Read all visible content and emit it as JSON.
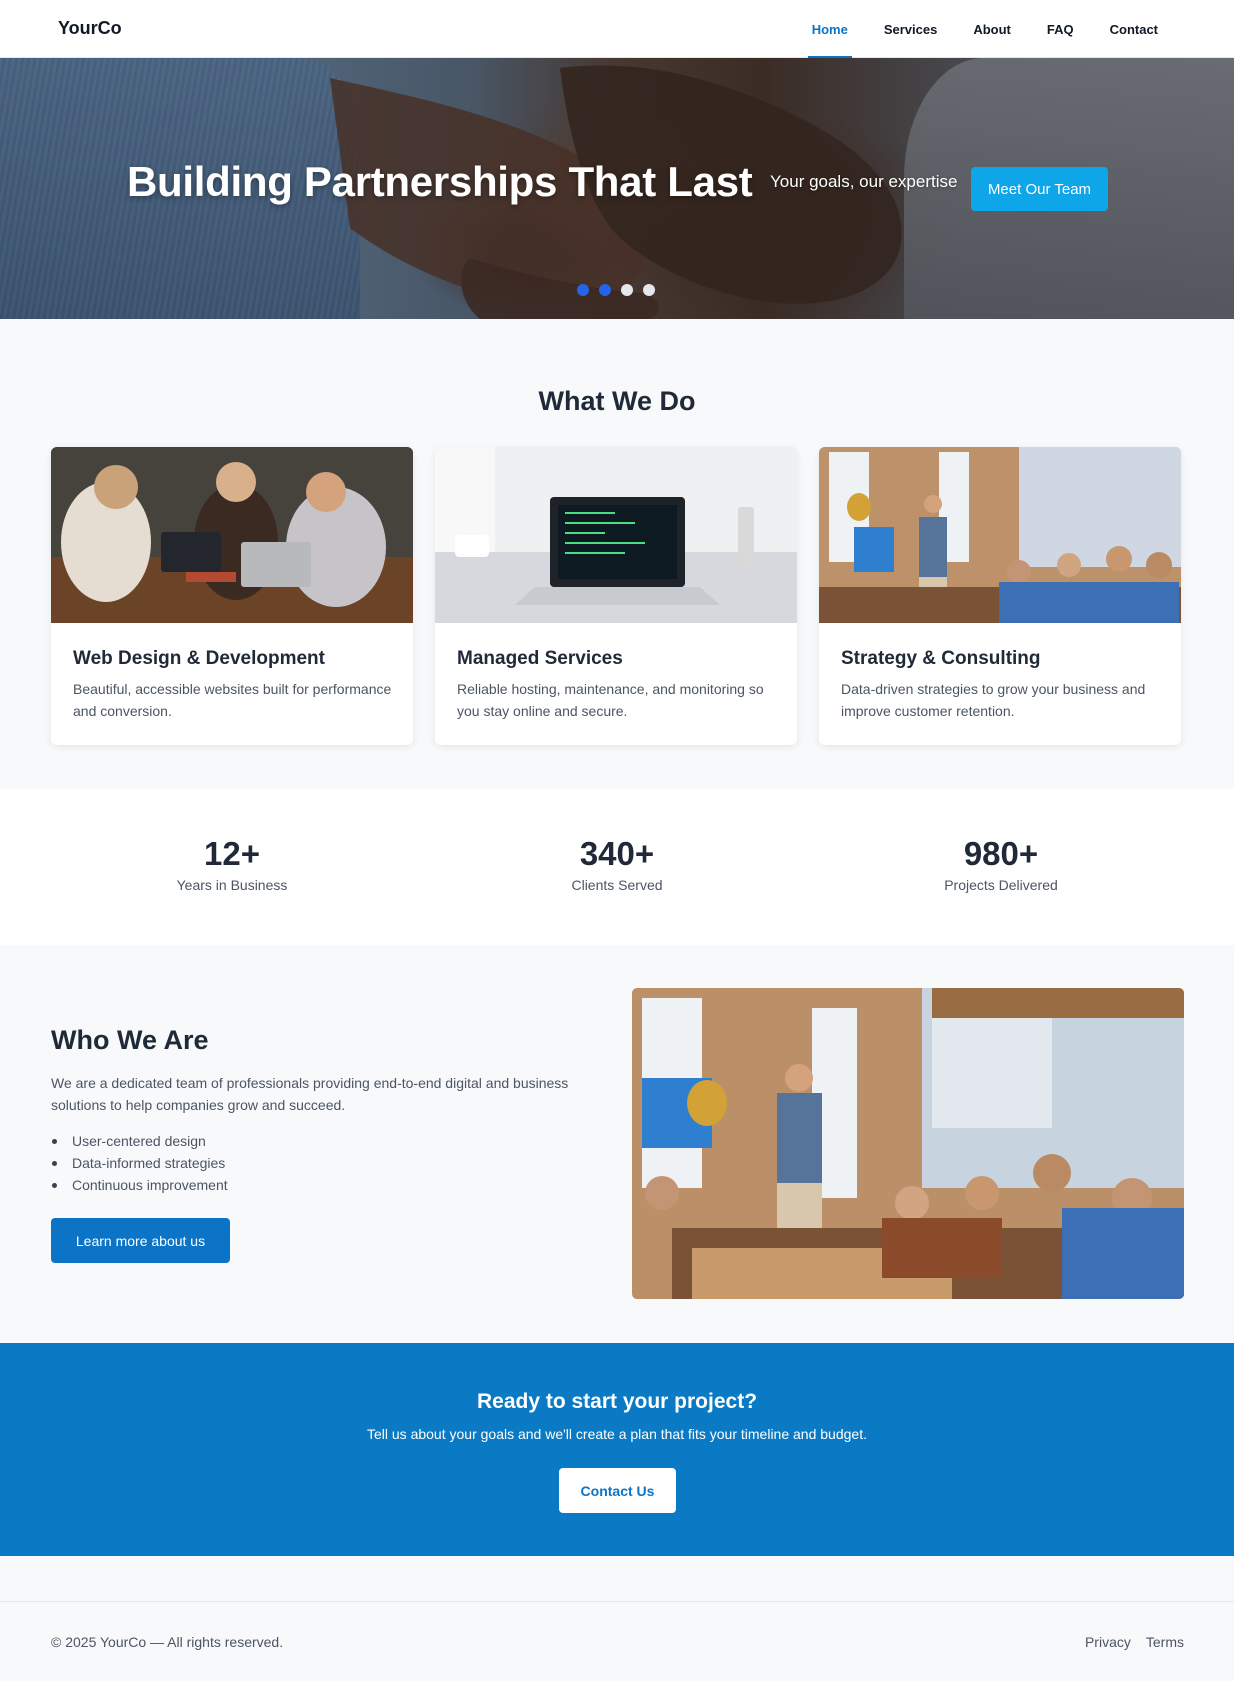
{
  "header": {
    "logo": "YourCo",
    "nav": [
      {
        "label": "Home",
        "active": true
      },
      {
        "label": "Services",
        "active": false
      },
      {
        "label": "About",
        "active": false
      },
      {
        "label": "FAQ",
        "active": false
      },
      {
        "label": "Contact",
        "active": false
      }
    ]
  },
  "hero": {
    "title": "Building Partnerships That Last",
    "subtitle": "Your goals, our expertise",
    "button": "Meet Our Team",
    "slide_count": 4,
    "active_slide": 2
  },
  "services": {
    "title": "What We Do",
    "cards": [
      {
        "title": "Web Design & Development",
        "description": "Beautiful, accessible websites built for performance and conversion."
      },
      {
        "title": "Managed Services",
        "description": "Reliable hosting, maintenance, and monitoring so you stay online and secure."
      },
      {
        "title": "Strategy & Consulting",
        "description": "Data-driven strategies to grow your business and improve customer retention."
      }
    ]
  },
  "stats": [
    {
      "value": "12+",
      "label": "Years in Business"
    },
    {
      "value": "340+",
      "label": "Clients Served"
    },
    {
      "value": "980+",
      "label": "Projects Delivered"
    }
  ],
  "about": {
    "title": "Who We Are",
    "text": "We are a dedicated team of professionals providing end-to-end digital and business solutions to help companies grow and succeed.",
    "points": [
      "User-centered design",
      "Data-informed strategies",
      "Continuous improvement"
    ],
    "button": "Learn more about us"
  },
  "cta": {
    "title": "Ready to start your project?",
    "text": "Tell us about your goals and we'll create a plan that fits your timeline and budget.",
    "button": "Contact Us"
  },
  "footer": {
    "copyright": "© 2025 YourCo — All rights reserved.",
    "links": [
      "Privacy",
      "Terms"
    ]
  },
  "colors": {
    "primary": "#0b74c7",
    "hero_button": "#0ea5e9",
    "cta_background": "#0b7ac4",
    "active_dot": "#2563eb"
  }
}
